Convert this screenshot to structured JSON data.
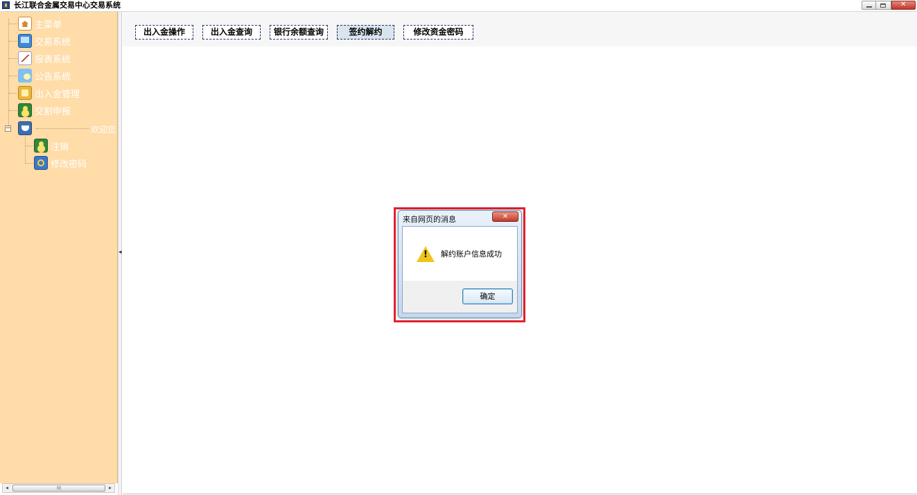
{
  "window": {
    "title": "长江联合金属交易中心交易系统"
  },
  "sidebar": {
    "items": [
      {
        "label": "主菜单",
        "icon": "home-icon"
      },
      {
        "label": "交易系统",
        "icon": "monitor-icon"
      },
      {
        "label": "报表系统",
        "icon": "chart-icon"
      },
      {
        "label": "公告系统",
        "icon": "speech-bubble-icon"
      },
      {
        "label": "出入金管理",
        "icon": "money-icon"
      },
      {
        "label": "交割申报",
        "icon": "user-icon"
      }
    ],
    "welcome": {
      "label": "欢迎您",
      "icon": "cup-icon",
      "expander": "−"
    },
    "subitems": [
      {
        "label": "注销",
        "icon": "user-icon"
      },
      {
        "label": "修改密码",
        "icon": "key-icon"
      }
    ],
    "scrollbar_grip": "III"
  },
  "toolbar": {
    "buttons": [
      {
        "label": "出入金操作"
      },
      {
        "label": "出入金查询"
      },
      {
        "label": "银行余额查询"
      },
      {
        "label": "签约解约"
      },
      {
        "label": "修改资金密码"
      }
    ],
    "active_button": "签约解约"
  },
  "dialog": {
    "title": "来自网页的消息",
    "message": "解约账户信息成功",
    "ok_label": "确定",
    "icon": "warning-icon",
    "highlight_color": "#e4202e"
  },
  "colors": {
    "sidebar_bg": "#ffdca8",
    "sidebar_text": "#ffffff",
    "button_border": "#1f2f6a"
  }
}
